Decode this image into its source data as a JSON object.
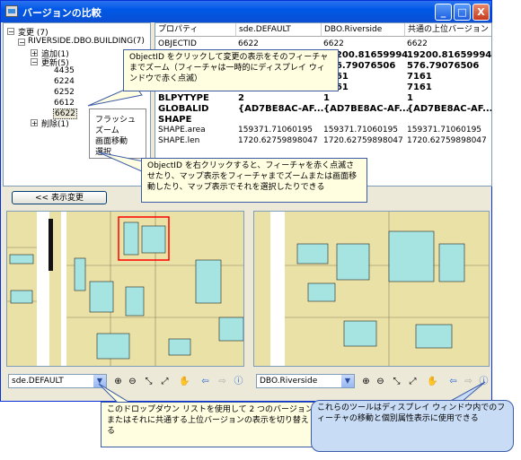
{
  "window": {
    "title": "バージョンの比較",
    "min": "_",
    "max": "□",
    "close": "X"
  },
  "tree": {
    "root": "変更 (7)",
    "dataset": "RIVERSIDE.DBO.BUILDING(7)",
    "added": "追加(1)",
    "updated": "更新(5)",
    "deleted": "削除(1)",
    "ids": [
      "4435",
      "6224",
      "6252",
      "6612",
      "6622"
    ]
  },
  "context_menu": {
    "items": [
      "フラッシュ",
      "ズーム",
      "画面移動",
      "選択"
    ]
  },
  "grid": {
    "columns": [
      "プロパティ",
      "sde.DEFAULT",
      "DBO.Riverside",
      "共通の上位バージョン"
    ],
    "rows": [
      {
        "p": "OBJECTID",
        "a": "6622",
        "b": "6622",
        "c": "6622",
        "bold": false
      },
      {
        "p": "",
        "a": "",
        "b": "19200.81659994",
        "c": "19200.81659994",
        "bold": true
      },
      {
        "p": "",
        "a": "",
        "b": "576.79076506",
        "c": "576.79076506",
        "bold": true
      },
      {
        "p": "",
        "a": "",
        "b": "7161",
        "c": "7161",
        "bold": true
      },
      {
        "p": "",
        "a": "",
        "b": "7161",
        "c": "7161",
        "bold": true
      },
      {
        "p": "BLPYTYPE",
        "a": "2",
        "b": "1",
        "c": "1",
        "bold": true
      },
      {
        "p": "GLOBALID",
        "a": "{AD7BE8AC-AF...",
        "b": "{AD7BE8AC-AF...",
        "c": "{AD7BE8AC-AF...",
        "bold": true
      },
      {
        "p": "SHAPE",
        "a": "",
        "b": "",
        "c": "",
        "bold": true
      },
      {
        "p": "SHAPE.area",
        "a": "159371.71060195",
        "b": "159371.71060195",
        "c": "159371.71060195",
        "bold": false
      },
      {
        "p": "SHAPE.len",
        "a": "1720.62759898047",
        "b": "1720.62759898047",
        "c": "1720.62759898047",
        "bold": false
      }
    ]
  },
  "show_button": "<< 表示変更",
  "left_combo": "sde.DEFAULT",
  "right_combo": "DBO.Riverside",
  "tools": {
    "zoom_in": "⊕",
    "zoom_out": "⊖",
    "full_ext": "⤢",
    "fixed_zoom": "⤡",
    "pan": "✋",
    "back": "⇦",
    "forward": "⇨",
    "identify": "ⓘ"
  },
  "callouts": {
    "top": "ObjectID をクリックして変更の表示をそのフィーチャまでズーム（フィーチャは一時的にディスプレイ ウィンドウで赤く点滅）",
    "middle": "ObjectID を右クリックすると、フィーチャを赤く点滅させたり、マップ表示をフィーチャまでズームまたは画面移動したり、マップ表示でそれを選択したりできる",
    "bottom_left": "このドロップダウン リストを使用して 2 つのバージョンまたはそれに共通する上位バージョンの表示を切り替える",
    "bottom_right": "これらのツールはディスプレイ ウィンドウ内でのフィーチャの移動と個別属性表示に使用できる"
  },
  "colors": {
    "parcel": "#e9e1a6",
    "building": "#a6e4e2",
    "road": "#ffffff",
    "flash": "#ff0000"
  }
}
